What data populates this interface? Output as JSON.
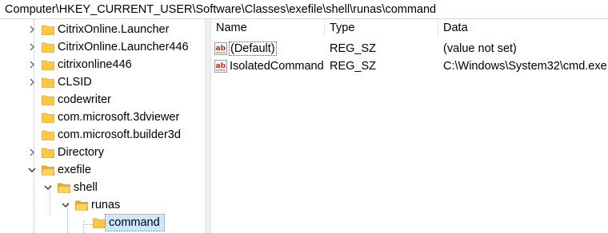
{
  "address_bar": {
    "path": "Computer\\HKEY_CURRENT_USER\\Software\\Classes\\exefile\\shell\\runas\\command"
  },
  "tree": {
    "items": [
      {
        "label": "CitrixOnline.Launcher",
        "expander": "collapsed"
      },
      {
        "label": "CitrixOnline.Launcher446",
        "expander": "collapsed"
      },
      {
        "label": "citrixonline446",
        "expander": "collapsed"
      },
      {
        "label": "CLSID",
        "expander": "collapsed"
      },
      {
        "label": "codewriter",
        "expander": "none"
      },
      {
        "label": "com.microsoft.3dviewer",
        "expander": "none"
      },
      {
        "label": "com.microsoft.builder3d",
        "expander": "none"
      },
      {
        "label": "Directory",
        "expander": "collapsed"
      },
      {
        "label": "exefile",
        "expander": "expanded"
      },
      {
        "label": "shell",
        "expander": "expanded"
      },
      {
        "label": "runas",
        "expander": "expanded"
      },
      {
        "label": "command",
        "expander": "none",
        "selected": true
      }
    ]
  },
  "values_list": {
    "columns": [
      "Name",
      "Type",
      "Data"
    ],
    "rows": [
      {
        "icon": "string-value-icon",
        "name": "(Default)",
        "type": "REG_SZ",
        "data": "(value not set)"
      },
      {
        "icon": "string-value-icon",
        "name": "IsolatedCommand",
        "type": "REG_SZ",
        "data": "C:\\Windows\\System32\\cmd.exe"
      }
    ]
  },
  "colors": {
    "folder": "#ffc83d",
    "selection": "#cce8ff",
    "string_icon_red": "#c42b1c"
  }
}
